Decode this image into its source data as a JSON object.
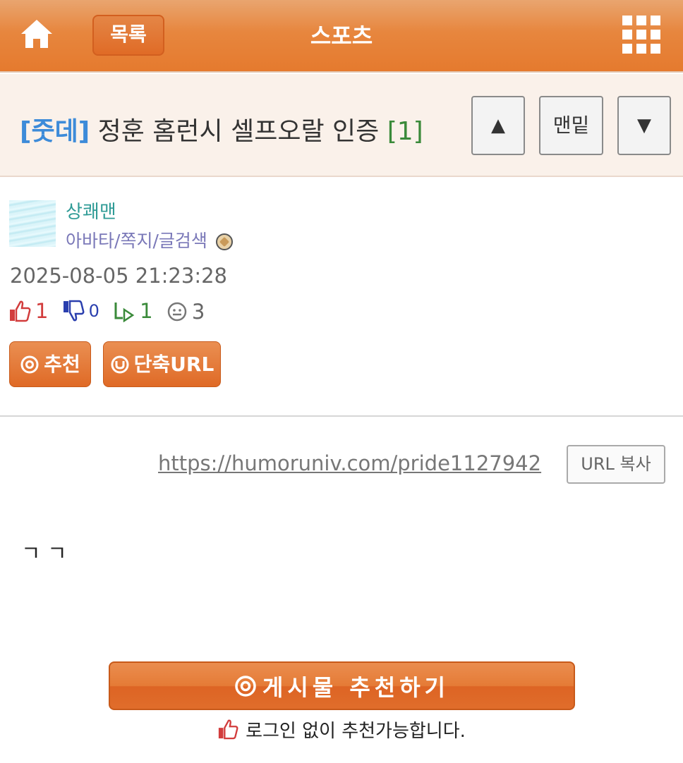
{
  "header": {
    "list_label": "목록",
    "title": "스포츠",
    "home_icon": "home-icon",
    "menu_icon": "grid-menu-icon"
  },
  "post": {
    "category": "[줏데]",
    "title": "정훈 홈런시 셀프오랄 인증",
    "comment_count": "[1]",
    "nav": {
      "up": "▲",
      "bottom": "맨밑",
      "down": "▼"
    }
  },
  "author": {
    "name": "상쾌맨",
    "links": [
      "아바타",
      "쪽지",
      "글검색"
    ],
    "separator": "/",
    "date": "2025-08-05 21:23:28"
  },
  "stats": {
    "up": "1",
    "down": "0",
    "share": "1",
    "views": "3"
  },
  "actions": {
    "recommend": "추천",
    "short_url": "단축URL"
  },
  "url": {
    "link": "https://humoruniv.com/pride1127942",
    "copy_label": "URL 복사"
  },
  "body": {
    "text": "ㄱ ㄱ"
  },
  "footer": {
    "recommend_button": "게시물 추천하기",
    "note": "로그인 없이 추천가능합니다."
  },
  "colors": {
    "accent": "#e57a2e",
    "category": "#3d8bd9",
    "comment_count": "#3a8a3a",
    "author": "#2f9b96",
    "up": "#d23c3c",
    "down": "#2a3fae"
  }
}
